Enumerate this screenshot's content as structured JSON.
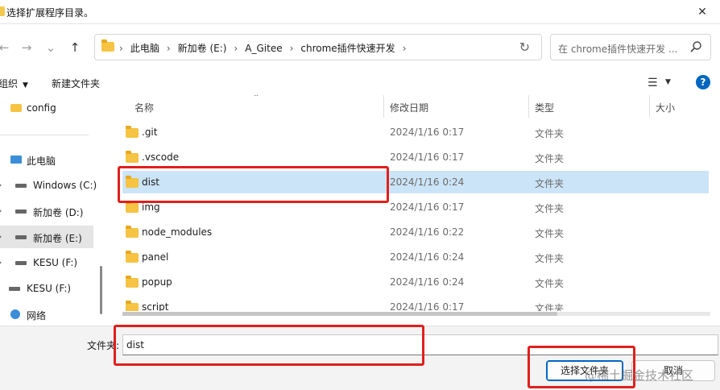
{
  "window": {
    "title": "选择扩展程序目录。"
  },
  "nav": {
    "back": "←",
    "forward": "→",
    "recent": "⌄",
    "up": "↑",
    "breadcrumbs": [
      "此电脑",
      "新加卷 (E:)",
      "A_Gitee",
      "chrome插件快速开发"
    ],
    "search_placeholder": "在 chrome插件快速开发 ..."
  },
  "toolbar": {
    "organize": "组织",
    "new_folder": "新建文件夹"
  },
  "sidebar": {
    "items": [
      {
        "label": "config",
        "icon": "folder-icon"
      },
      {
        "label": "此电脑",
        "icon": "computer-icon"
      },
      {
        "label": "Windows (C:)",
        "icon": "windows-drive-icon"
      },
      {
        "label": "新加卷 (D:)",
        "icon": "drive-icon"
      },
      {
        "label": "新加卷 (E:)",
        "icon": "drive-icon"
      },
      {
        "label": "KESU (F:)",
        "icon": "drive-icon"
      },
      {
        "label": "KESU (F:)",
        "icon": "drive-icon"
      },
      {
        "label": "网络",
        "icon": "network-icon"
      }
    ]
  },
  "columns": {
    "name": "名称",
    "date": "修改日期",
    "type": "类型",
    "size": "大小"
  },
  "files": [
    {
      "name": ".git",
      "date": "2024/1/16 0:17",
      "type": "文件夹"
    },
    {
      "name": ".vscode",
      "date": "2024/1/16 0:17",
      "type": "文件夹"
    },
    {
      "name": "dist",
      "date": "2024/1/16 0:24",
      "type": "文件夹"
    },
    {
      "name": "img",
      "date": "2024/1/16 0:17",
      "type": "文件夹"
    },
    {
      "name": "node_modules",
      "date": "2024/1/16 0:22",
      "type": "文件夹"
    },
    {
      "name": "panel",
      "date": "2024/1/16 0:24",
      "type": "文件夹"
    },
    {
      "name": "popup",
      "date": "2024/1/16 0:24",
      "type": "文件夹"
    },
    {
      "name": "script",
      "date": "2024/1/16 0:17",
      "type": "文件夹"
    }
  ],
  "footer": {
    "folder_label": "文件夹:",
    "folder_value": "dist",
    "select_button": "选择文件夹",
    "cancel_button": "取消"
  },
  "watermark": "@稀土掘金技术社区",
  "colors": {
    "selection": "#cce4f7",
    "highlight": "#e0201c",
    "accent": "#0067c0"
  }
}
